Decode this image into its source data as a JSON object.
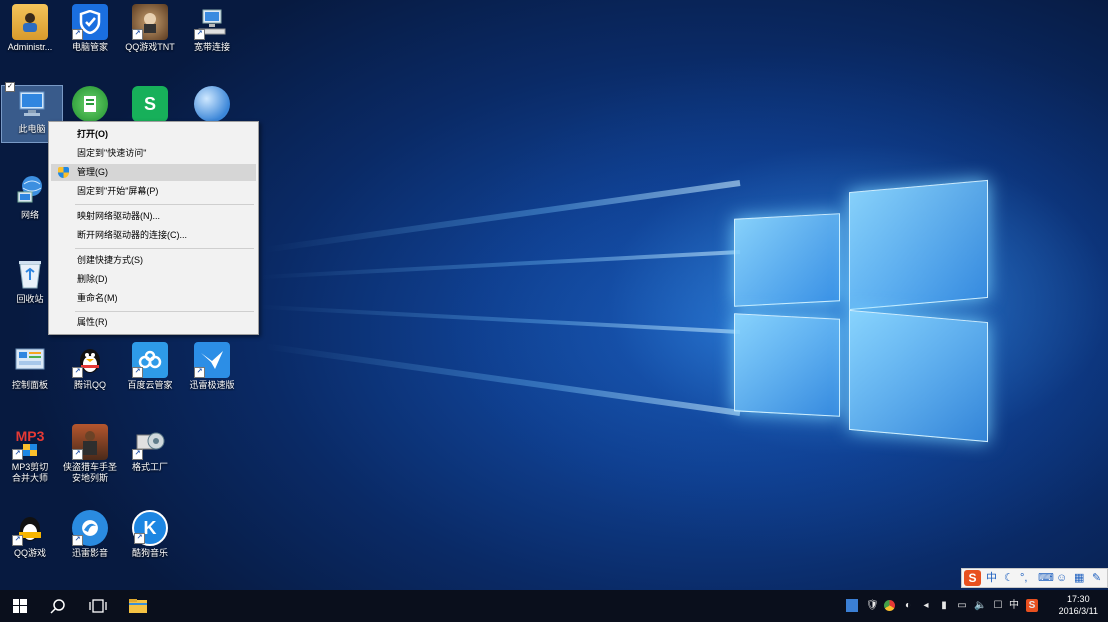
{
  "desktop": {
    "icons": [
      {
        "label": "Administr..."
      },
      {
        "label": "电脑管家"
      },
      {
        "label": "QQ游戏TNT"
      },
      {
        "label": "宽带连接"
      },
      {
        "label": "此电脑"
      },
      {
        "label": "网络"
      },
      {
        "label": "回收站"
      },
      {
        "label": "控制面板"
      },
      {
        "label": "腾讯QQ"
      },
      {
        "label": "百度云管家"
      },
      {
        "label": "迅雷极速版"
      },
      {
        "label": "MP3剪切合并大师"
      },
      {
        "label": "侠盗猎车手圣安地列斯"
      },
      {
        "label": "格式工厂"
      },
      {
        "label": "QQ游戏"
      },
      {
        "label": "迅雷影音"
      },
      {
        "label": "酷狗音乐"
      }
    ],
    "mp3_icon_text": "MP3",
    "wps_icon_text": "S",
    "kugou_icon_text": "K"
  },
  "context_menu": {
    "items": [
      {
        "label": "打开(O)"
      },
      {
        "label": "固定到\"快速访问\""
      },
      {
        "label": "管理(G)"
      },
      {
        "label": "固定到\"开始\"屏幕(P)"
      },
      {
        "label": "映射网络驱动器(N)..."
      },
      {
        "label": "断开网络驱动器的连接(C)..."
      },
      {
        "label": "创建快捷方式(S)"
      },
      {
        "label": "删除(D)"
      },
      {
        "label": "重命名(M)"
      },
      {
        "label": "属性(R)"
      }
    ],
    "hovered": "管理(G)"
  },
  "ime_bar": {
    "logo": "S",
    "mode": "中"
  },
  "taskbar": {
    "tray_language": "中",
    "clock_time": "17:30",
    "clock_date": "2016/3/11"
  },
  "colors": {
    "taskbar": "#0a0f1c",
    "menu_bg": "#f2f2f2",
    "menu_hover": "#d6d6d6",
    "accent": "#1e88e5",
    "ime_logo": "#e8501f"
  }
}
